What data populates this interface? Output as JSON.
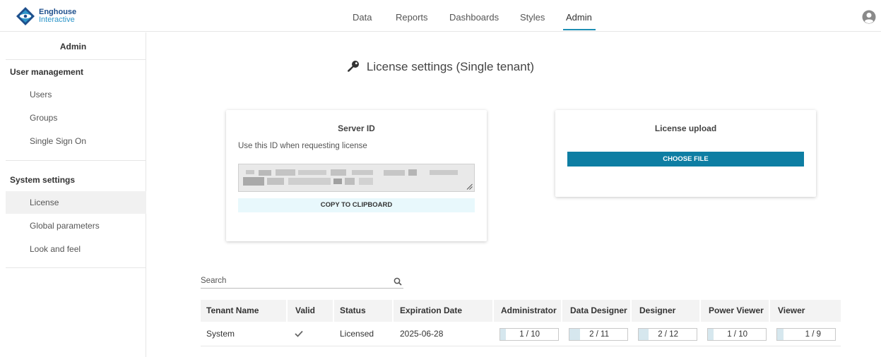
{
  "app": {
    "logo_line1": "Enghouse",
    "logo_line2": "Interactive"
  },
  "nav": {
    "items": [
      {
        "label": "Data"
      },
      {
        "label": "Reports"
      },
      {
        "label": "Dashboards"
      },
      {
        "label": "Styles"
      },
      {
        "label": "Admin",
        "active": true
      }
    ]
  },
  "sidebar": {
    "title": "Admin",
    "sections": [
      {
        "label": "User management",
        "items": [
          {
            "label": "Users"
          },
          {
            "label": "Groups"
          },
          {
            "label": "Single Sign On"
          }
        ]
      },
      {
        "label": "System settings",
        "items": [
          {
            "label": "License",
            "active": true
          },
          {
            "label": "Global parameters"
          },
          {
            "label": "Look and feel"
          }
        ]
      }
    ]
  },
  "page": {
    "title": "License settings (Single tenant)"
  },
  "server_id_card": {
    "title": "Server ID",
    "subtitle": "Use this ID when requesting license",
    "copy_label": "COPY TO CLIPBOARD"
  },
  "upload_card": {
    "title": "License upload",
    "choose_label": "CHOOSE FILE"
  },
  "search": {
    "placeholder": "Search"
  },
  "table": {
    "columns": [
      "Tenant Name",
      "Valid",
      "Status",
      "Expiration Date",
      "Administrator",
      "Data Designer",
      "Designer",
      "Power Viewer",
      "Viewer"
    ],
    "rows": [
      {
        "tenant": "System",
        "valid": true,
        "status": "Licensed",
        "expiration": "2025-06-28",
        "licenses": [
          {
            "text": "1 / 10",
            "used": 1,
            "total": 10
          },
          {
            "text": "2 / 11",
            "used": 2,
            "total": 11
          },
          {
            "text": "2 / 12",
            "used": 2,
            "total": 12
          },
          {
            "text": "1 / 10",
            "used": 1,
            "total": 10
          },
          {
            "text": "1 / 9",
            "used": 1,
            "total": 9
          }
        ]
      }
    ]
  },
  "colors": {
    "accent": "#1e8fb4",
    "button_primary": "#0e7ea3",
    "button_secondary_bg": "#e8f8fc"
  }
}
